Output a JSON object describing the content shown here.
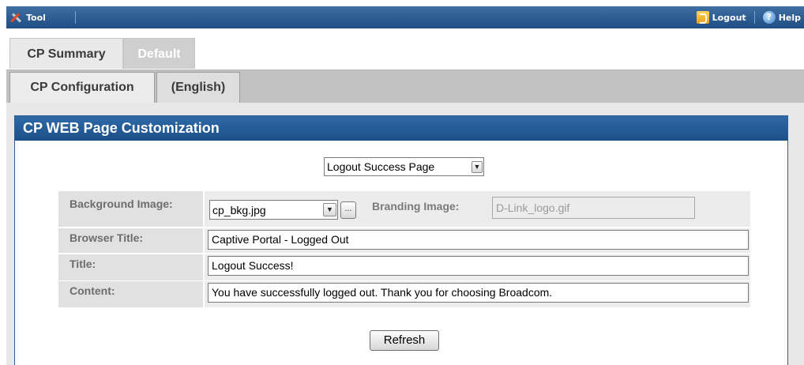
{
  "topbar": {
    "tool_label": "Tool",
    "logout_label": "Logout",
    "help_label": "Help"
  },
  "tabs_level1": [
    {
      "label": "CP Summary"
    },
    {
      "label": "Default"
    }
  ],
  "tabs_level2": [
    {
      "label": "CP Configuration"
    },
    {
      "label": "(English)"
    }
  ],
  "panel": {
    "title": "CP WEB Page Customization"
  },
  "page_select": {
    "value": "Logout Success Page"
  },
  "form": {
    "background_image": {
      "label": "Background Image:",
      "value": "cp_bkg.jpg",
      "browse_label": "..."
    },
    "branding_image": {
      "label": "Branding Image:",
      "value": "D-Link_logo.gif"
    },
    "browser_title": {
      "label": "Browser Title:",
      "value": "Captive Portal - Logged Out"
    },
    "title": {
      "label": "Title:",
      "value": "Logout Success!"
    },
    "content": {
      "label": "Content:",
      "value": "You have successfully logged out. Thank you for choosing Broadcom."
    }
  },
  "refresh_label": "Refresh",
  "colors": {
    "header_blue": "#1f4d84",
    "panel_blue": "#2f6aa8",
    "tab_grey": "#c2c2c2"
  }
}
